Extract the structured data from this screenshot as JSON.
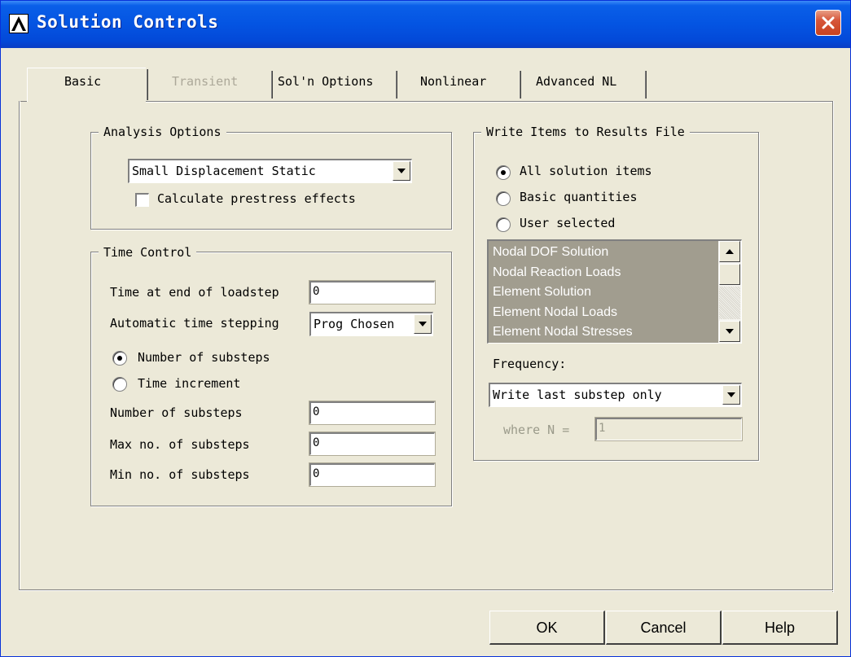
{
  "window": {
    "title": "Solution Controls"
  },
  "tabs": [
    {
      "label": "Basic",
      "active": true,
      "enabled": true
    },
    {
      "label": "Transient",
      "active": false,
      "enabled": false
    },
    {
      "label": "Sol'n Options",
      "active": false,
      "enabled": true
    },
    {
      "label": "Nonlinear",
      "active": false,
      "enabled": true
    },
    {
      "label": "Advanced NL",
      "active": false,
      "enabled": true
    }
  ],
  "analysis_options": {
    "group_label": "Analysis Options",
    "analysis_type": "Small Displacement Static",
    "prestress_label": "Calculate prestress effects",
    "prestress_checked": false
  },
  "time_control": {
    "group_label": "Time Control",
    "time_end_label": "Time at end of loadstep",
    "time_end_value": "0",
    "auto_stepping_label": "Automatic time stepping",
    "auto_stepping_value": "Prog Chosen",
    "radio_substeps_label": "Number of substeps",
    "radio_increment_label": "Time increment",
    "selected_radio": "substeps",
    "num_substeps_label": "Number of substeps",
    "num_substeps_value": "0",
    "max_substeps_label": "Max no. of substeps",
    "max_substeps_value": "0",
    "min_substeps_label": "Min no. of substeps",
    "min_substeps_value": "0"
  },
  "write_items": {
    "group_label": "Write Items to Results File",
    "radio_all_label": "All solution items",
    "radio_basic_label": "Basic quantities",
    "radio_user_label": "User selected",
    "selected_radio": "all",
    "list_items": [
      "Nodal DOF Solution",
      "Nodal Reaction Loads",
      "Element Solution",
      "Element Nodal Loads",
      "Element Nodal Stresses"
    ],
    "frequency_label": "Frequency:",
    "frequency_value": "Write last substep only",
    "where_n_label": "where N =",
    "where_n_value": "1"
  },
  "buttons": {
    "ok": "OK",
    "cancel": "Cancel",
    "help": "Help"
  },
  "colors": {
    "titlebar": "#0454e2",
    "dialog_bg": "#ece9d8",
    "close_button": "#d6563a",
    "list_bg": "#a19d8f"
  }
}
